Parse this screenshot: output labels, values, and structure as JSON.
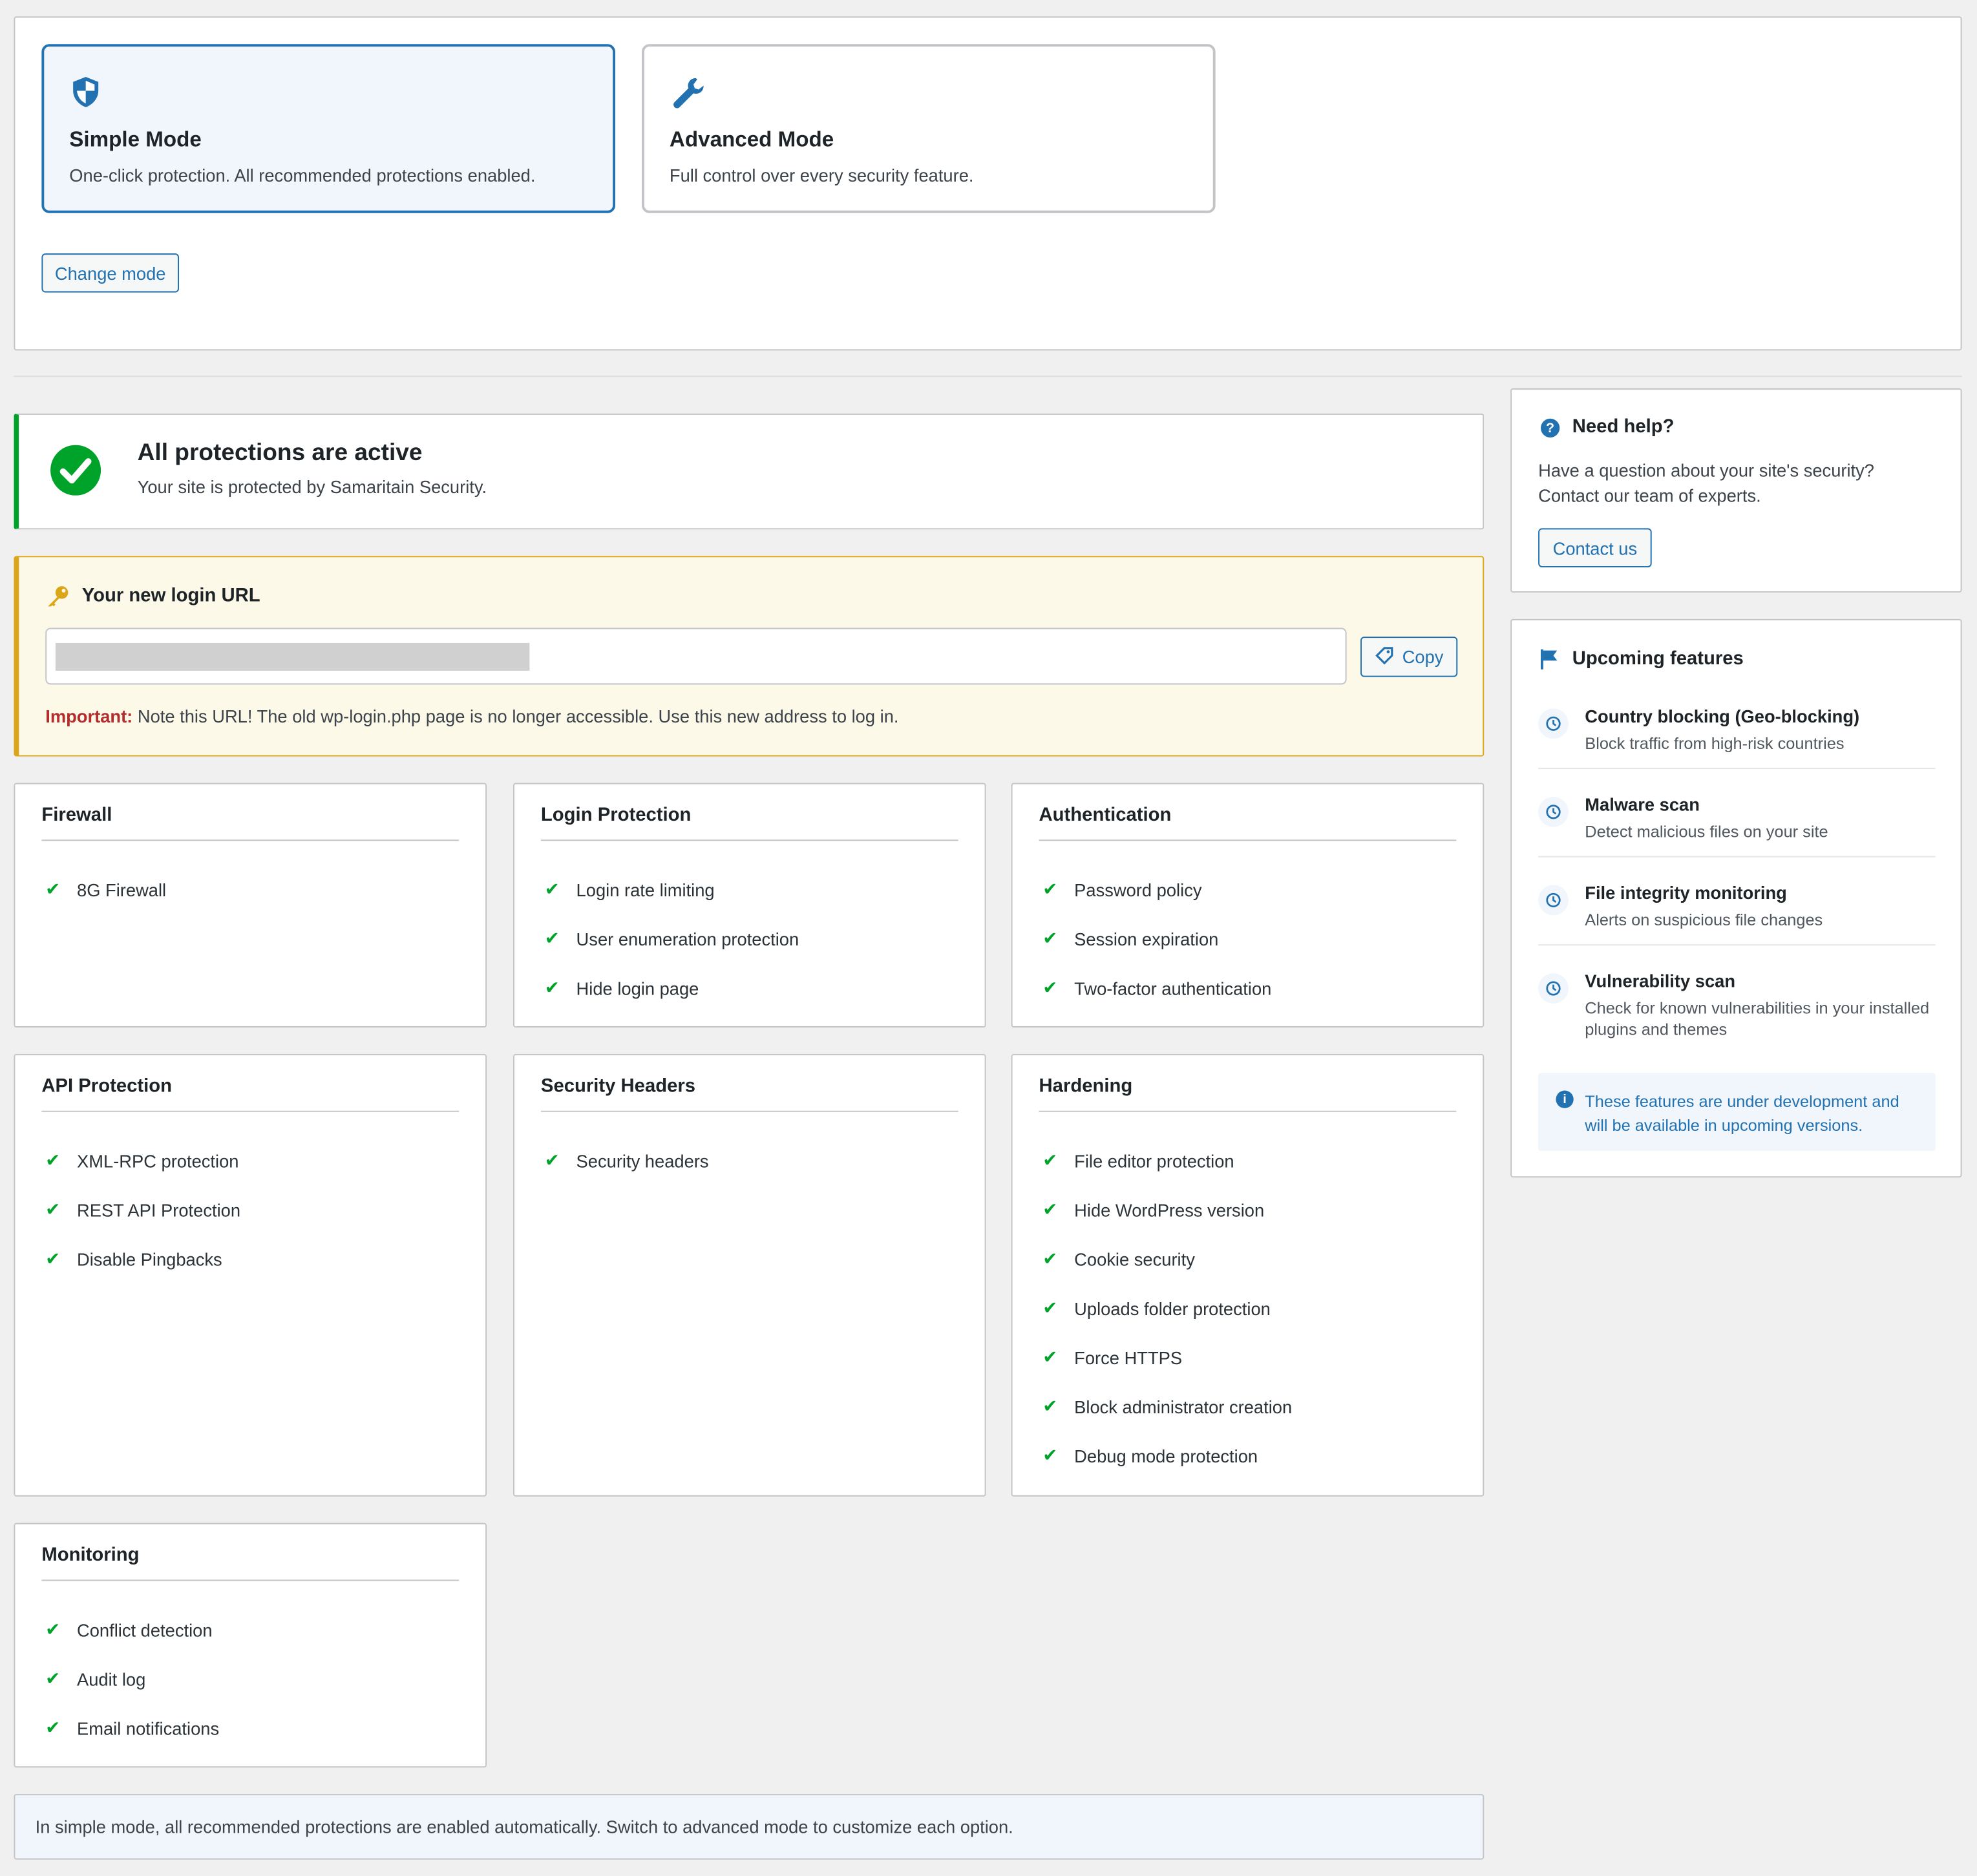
{
  "colors": {
    "accent": "#2271b1",
    "success": "#00a32a",
    "warning": "#dba617",
    "danger": "#b32d2e"
  },
  "modes": {
    "simple": {
      "title": "Simple Mode",
      "desc": "One-click protection. All recommended protections enabled.",
      "icon": "shield-icon",
      "selected": true
    },
    "advanced": {
      "title": "Advanced Mode",
      "desc": "Full control over every security feature.",
      "icon": "wrench-icon",
      "selected": false
    },
    "change_label": "Change mode"
  },
  "status": {
    "title": "All protections are active",
    "subtitle": "Your site is protected by Samaritain Security.",
    "icon": "check-circle-icon"
  },
  "login_url": {
    "title": "Your new login URL",
    "icon": "key-icon",
    "copy_label": "Copy",
    "important_label": "Important:",
    "note": " Note this URL! The old wp-login.php page is no longer accessible. Use this new address to log in."
  },
  "cards": {
    "firewall": {
      "title": "Firewall",
      "items": [
        "8G Firewall"
      ]
    },
    "login": {
      "title": "Login Protection",
      "items": [
        "Login rate limiting",
        "User enumeration protection",
        "Hide login page"
      ]
    },
    "auth": {
      "title": "Authentication",
      "items": [
        "Password policy",
        "Session expiration",
        "Two-factor authentication"
      ]
    },
    "api": {
      "title": "API Protection",
      "items": [
        "XML-RPC protection",
        "REST API Protection",
        "Disable Pingbacks"
      ]
    },
    "headers": {
      "title": "Security Headers",
      "items": [
        "Security headers"
      ]
    },
    "hardening": {
      "title": "Hardening",
      "items": [
        "File editor protection",
        "Hide WordPress version",
        "Cookie security",
        "Uploads folder protection",
        "Force HTTPS",
        "Block administrator creation",
        "Debug mode protection"
      ]
    },
    "monitoring": {
      "title": "Monitoring",
      "items": [
        "Conflict detection",
        "Audit log",
        "Email notifications"
      ]
    }
  },
  "footer_note": "In simple mode, all recommended protections are enabled automatically. Switch to advanced mode to customize each option.",
  "help": {
    "title": "Need help?",
    "text_line1": "Have a question about your site's security?",
    "text_line2": "Contact our team of experts.",
    "contact_label": "Contact us"
  },
  "upcoming": {
    "title": "Upcoming features",
    "items": [
      {
        "title": "Country blocking (Geo-blocking)",
        "desc": "Block traffic from high-risk countries"
      },
      {
        "title": "Malware scan",
        "desc": "Detect malicious files on your site"
      },
      {
        "title": "File integrity monitoring",
        "desc": "Alerts on suspicious file changes"
      },
      {
        "title": "Vulnerability scan",
        "desc": "Check for known vulnerabilities in your installed plugins and themes"
      }
    ],
    "info": "These features are under development and will be available in upcoming versions."
  }
}
